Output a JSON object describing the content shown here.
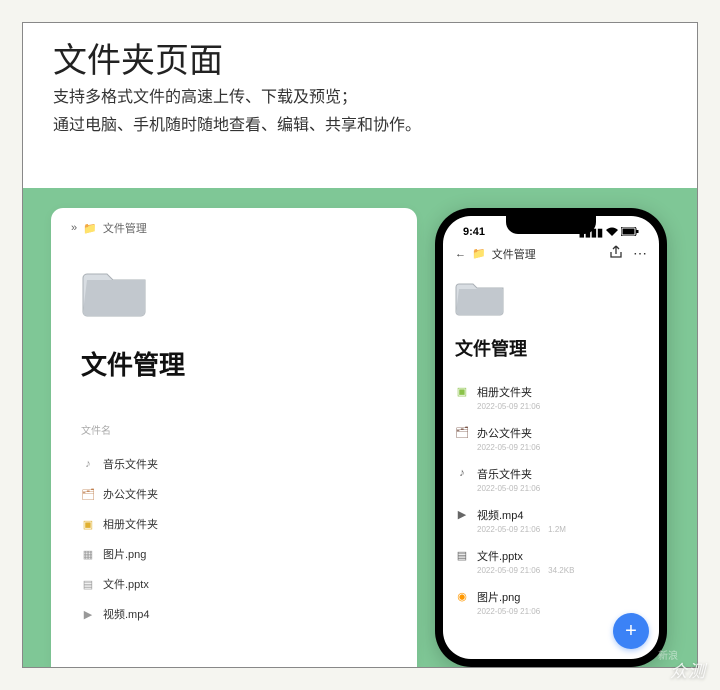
{
  "header": {
    "title": "文件夹页面",
    "subtitle_line1": "支持多格式文件的高速上传、下载及预览；",
    "subtitle_line2": "通过电脑、手机随时随地查看、编辑、共享和协作。"
  },
  "desktop": {
    "breadcrumb_icon": "»",
    "breadcrumb_text": "文件管理",
    "heading": "文件管理",
    "column_name": "文件名",
    "items": [
      {
        "icon": "♪",
        "name": "音乐文件夹",
        "color": "#999"
      },
      {
        "icon": "🗂",
        "name": "办公文件夹",
        "color": "#c08050"
      },
      {
        "icon": "▣",
        "name": "相册文件夹",
        "color": "#e0b030"
      },
      {
        "icon": "▦",
        "name": "图片.png",
        "color": "#999"
      },
      {
        "icon": "▤",
        "name": "文件.pptx",
        "color": "#999"
      },
      {
        "icon": "▶",
        "name": "视频.mp4",
        "color": "#999"
      }
    ]
  },
  "phone": {
    "time": "9:41",
    "nav_back": "←",
    "nav_title": "文件管理",
    "heading": "文件管理",
    "items": [
      {
        "icon": "▣",
        "name": "相册文件夹",
        "date": "2022-05-09 21:06",
        "size": "",
        "color": "#8bc34a"
      },
      {
        "icon": "🗂",
        "name": "办公文件夹",
        "date": "2022-05-09 21:06",
        "size": "",
        "color": "#795548"
      },
      {
        "icon": "♪",
        "name": "音乐文件夹",
        "date": "2022-05-09 21:06",
        "size": "",
        "color": "#666"
      },
      {
        "icon": "▶",
        "name": "视频.mp4",
        "date": "2022-05-09 21:06",
        "size": "1.2M",
        "color": "#666"
      },
      {
        "icon": "▤",
        "name": "文件.pptx",
        "date": "2022-05-09 21:06",
        "size": "34.2KB",
        "color": "#666"
      },
      {
        "icon": "◉",
        "name": "图片.png",
        "date": "2022-05-09 21:06",
        "size": "",
        "color": "#ff9800"
      }
    ],
    "fab": "+"
  },
  "watermark": {
    "main": "众测",
    "sub": "新浪"
  }
}
